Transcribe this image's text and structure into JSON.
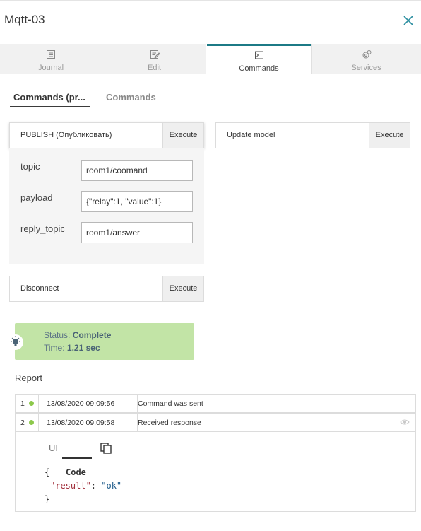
{
  "window": {
    "title": "Mqtt-03"
  },
  "tabs": [
    {
      "label": "Journal",
      "icon": "journal-icon",
      "active": false
    },
    {
      "label": "Edit",
      "icon": "edit-icon",
      "active": false
    },
    {
      "label": "Commands",
      "icon": "terminal-icon",
      "active": true
    },
    {
      "label": "Services",
      "icon": "services-icon",
      "active": false
    }
  ],
  "subtabs": [
    {
      "label": "Commands (pr...",
      "active": true
    },
    {
      "label": "Commands",
      "active": false
    }
  ],
  "commands": {
    "publish": {
      "label": "PUBLISH (Опубликовать)",
      "execute": "Execute"
    },
    "update_model": {
      "label": "Update model",
      "execute": "Execute"
    },
    "disconnect": {
      "label": "Disconnect",
      "execute": "Execute"
    }
  },
  "params": [
    {
      "label": "topic",
      "value": "room1/coomand"
    },
    {
      "label": "payload",
      "value": "{\"relay\":1, \"value\":1}"
    },
    {
      "label": "reply_topic",
      "value": "room1/answer"
    }
  ],
  "status": {
    "status_label": "Status:",
    "status_value": "Complete",
    "time_label": "Time:",
    "time_value": "1.21 sec",
    "color": "#c2e4a6"
  },
  "report": {
    "title": "Report",
    "rows": [
      {
        "num": "1",
        "date": "13/08/2020 09:09:56",
        "message": "Command was sent"
      },
      {
        "num": "2",
        "date": "13/08/2020 09:09:58",
        "message": "Received response"
      }
    ],
    "detail": {
      "tabs": [
        "UI",
        "Code"
      ],
      "active_tab": "Code",
      "code": {
        "open": "{",
        "key": "\"result\"",
        "colon": ": ",
        "value": "\"ok\"",
        "close": "}"
      }
    }
  },
  "colors": {
    "accent": "#1c7a86",
    "status_dot": "#8cc84b"
  }
}
